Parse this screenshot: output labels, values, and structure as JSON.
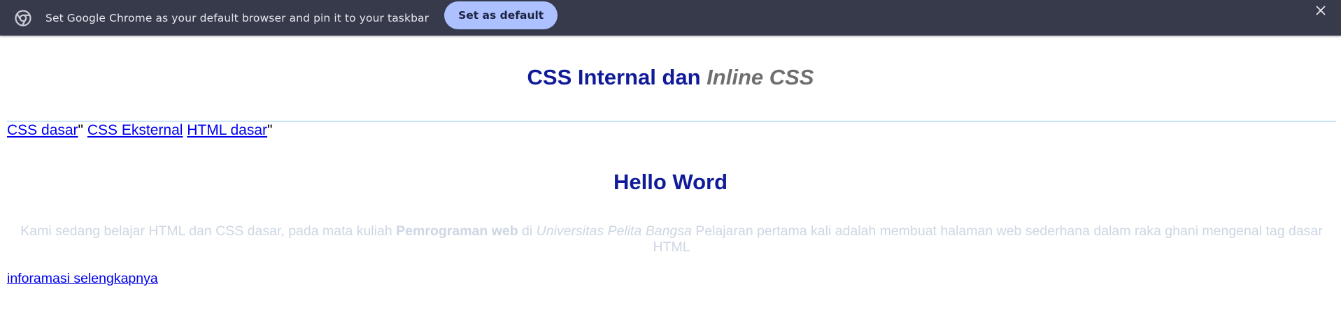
{
  "infobar": {
    "message": "Set Google Chrome as your default browser and pin it to your taskbar",
    "button_label": "Set as default",
    "close_symbol": "✕",
    "icon": "chrome-icon"
  },
  "page": {
    "title_main": "CSS Internal dan ",
    "title_inline": "Inline CSS",
    "nav": {
      "link1": "CSS dasar",
      "sep1": "\"",
      "link2": "CSS Eksternal",
      "link3": "HTML dasar",
      "sep2": "\""
    },
    "heading": "Hello Word",
    "paragraph": {
      "part1": "Kami sedang belajar HTML dan CSS dasar, pada mata kuliah ",
      "bold": "Pemrograman web",
      "part2": " di ",
      "italic": "Universitas Pelita Bangsa",
      "part3": " Pelajaran pertama kali adalah membuat halaman web sederhana dalam raka ghani mengenal tag dasar HTML"
    },
    "more_link": "inforamasi selengkapnya"
  },
  "colors": {
    "infobar_bg": "#363a4a",
    "button_bg": "#adc0ff",
    "heading": "#101b9a",
    "link": "#0000ee",
    "paragraph": "#cdd6e3"
  }
}
